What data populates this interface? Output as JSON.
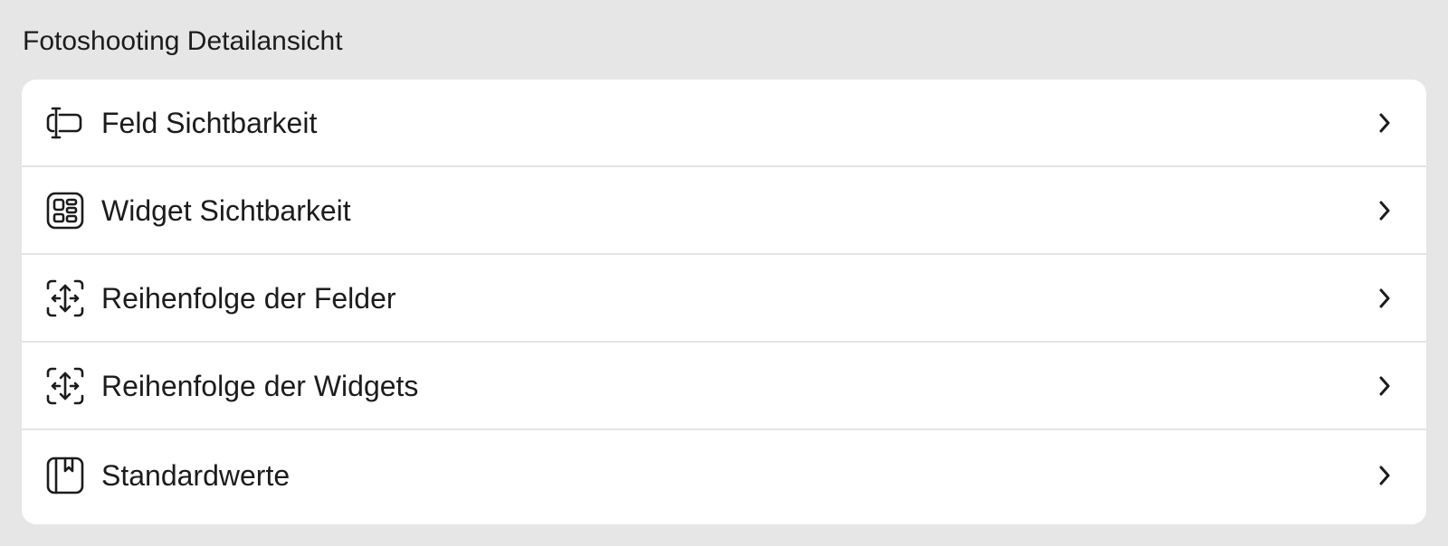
{
  "section": {
    "title": "Fotoshooting Detailansicht"
  },
  "menu": {
    "items": [
      {
        "label": "Feld Sichtbarkeit",
        "icon": "text-field-visibility-icon"
      },
      {
        "label": "Widget Sichtbarkeit",
        "icon": "widget-grid-icon"
      },
      {
        "label": "Reihenfolge der Felder",
        "icon": "reorder-arrows-icon"
      },
      {
        "label": "Reihenfolge der Widgets",
        "icon": "reorder-arrows-icon"
      },
      {
        "label": "Standardwerte",
        "icon": "bookmark-book-icon"
      }
    ]
  },
  "colors": {
    "background": "#e6e6e6",
    "card": "#ffffff",
    "divider": "#e4e4e4",
    "text": "#1c1c1e"
  }
}
